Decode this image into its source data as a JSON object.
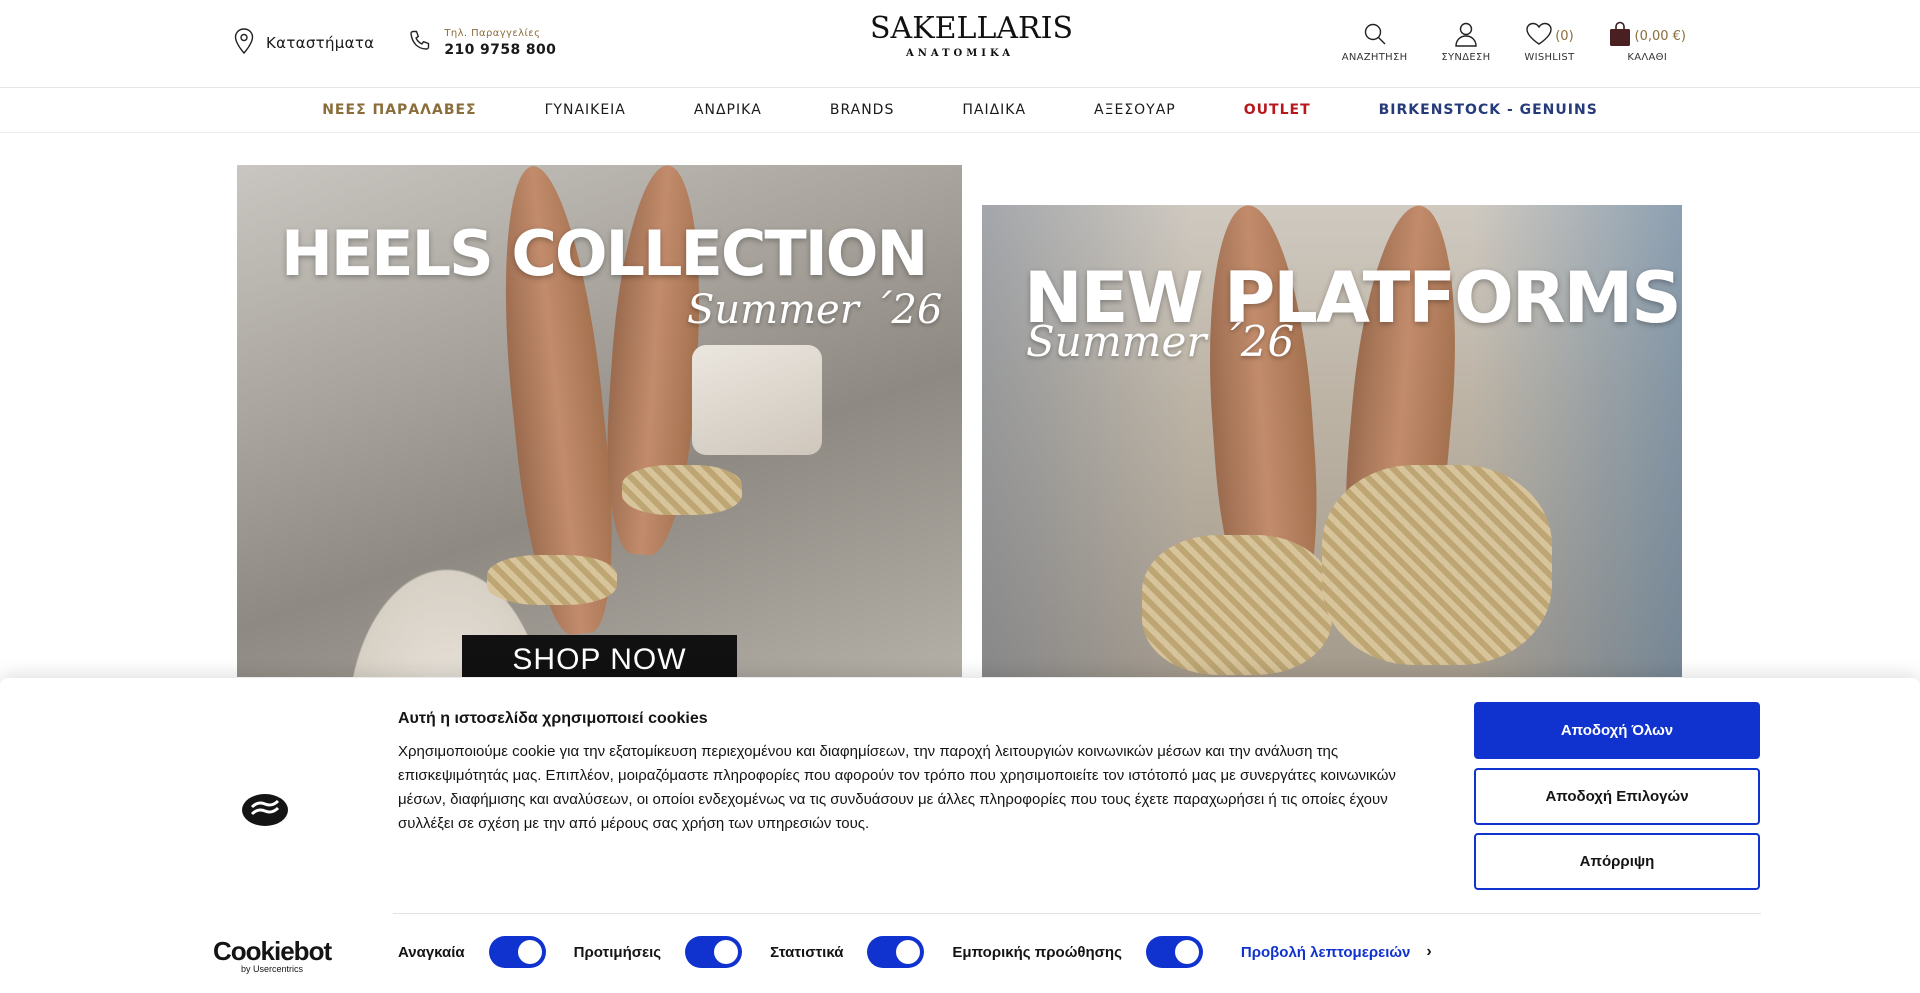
{
  "header": {
    "stores_label": "Καταστήματα",
    "phone_caption": "Τηλ. Παραγγελίες",
    "phone_number": "210 9758 800",
    "logo_main": "SAKELLARIS",
    "logo_sub": "ANATOMIKA",
    "search_label": "ΑΝΑΖΗΤΗΣΗ",
    "login_label": "ΣΥΝΔΕΣΗ",
    "wishlist_label": "WISHLIST",
    "wishlist_count": "(0)",
    "cart_label": "ΚΑΛΑΘΙ",
    "cart_total": "(0,00 €)"
  },
  "nav": {
    "items": [
      "ΝΕΕΣ ΠΑΡΑΛΑΒΕΣ",
      "ΓΥΝΑΙΚΕΙΑ",
      "ΑΝΔΡΙΚΑ",
      "BRANDS",
      "ΠΑΙΔΙΚΑ",
      "ΑΞΕΣΟΥΑΡ",
      "OUTLET",
      "BIRKENSTOCK - GENUINS"
    ]
  },
  "banners": {
    "left_title": "HEELS COLLECTION",
    "left_script": "Summer ´26",
    "left_cta": "SHOP NOW",
    "right_title": "NEW PLATFORMS",
    "right_script": "Summer ´26"
  },
  "cookie": {
    "title": "Αυτή η ιστοσελίδα χρησιμοποιεί cookies",
    "text": "Χρησιμοποιούμε cookie για την εξατομίκευση περιεχομένου και διαφημίσεων, την παροχή λειτουργιών κοινωνικών μέσων και την ανάλυση της επισκεψιμότητάς μας. Επιπλέον, μοιραζόμαστε πληροφορίες που αφορούν τον τρόπο που χρησιμοποιείτε τον ιστότοπό μας με συνεργάτες κοινωνικών μέσων, διαφήμισης και αναλύσεων, οι οποίοι ενδεχομένως να τις συνδυάσουν με άλλες πληροφορίες που τους έχετε παραχωρήσει ή τις οποίες έχουν συλλέξει σε σχέση με την από μέρους σας χρήση των υπηρεσιών τους.",
    "accept_all": "Αποδοχή Όλων",
    "accept_selection": "Αποδοχή Επιλογών",
    "reject": "Απόρριψη",
    "brand": "Cookiebot",
    "brand_by": "by Usercentrics",
    "toggles": [
      {
        "label": "Αναγκαία",
        "on": true
      },
      {
        "label": "Προτιμήσεις",
        "on": true
      },
      {
        "label": "Στατιστικά",
        "on": true
      },
      {
        "label": "Εμπορικής προώθησης",
        "on": true
      }
    ],
    "details_link": "Προβολή λεπτομερειών"
  },
  "colors": {
    "accent_blue": "#1032cf",
    "gold": "#8a6d3b",
    "outlet_red": "#b8171e",
    "birkenstock_blue": "#253b7a"
  }
}
